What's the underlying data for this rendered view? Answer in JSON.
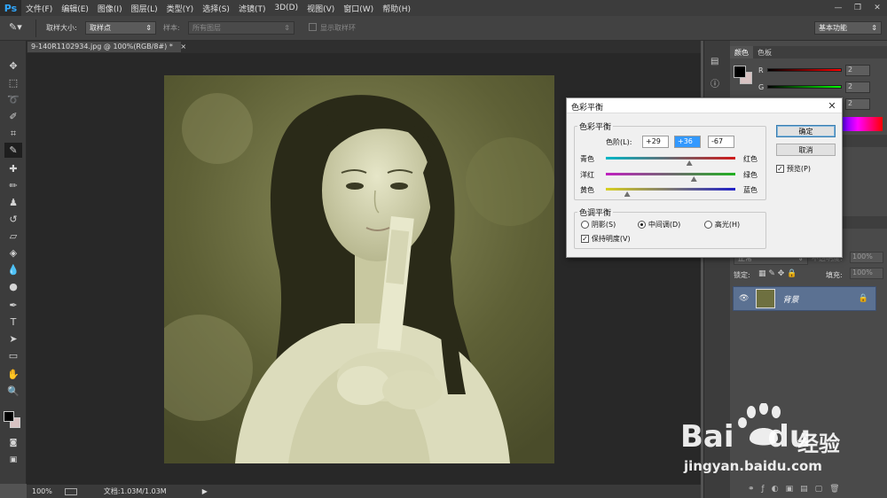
{
  "app": {
    "logo": "Ps"
  },
  "menu": [
    "文件(F)",
    "编辑(E)",
    "图像(I)",
    "图层(L)",
    "类型(Y)",
    "选择(S)",
    "滤镜(T)",
    "3D(D)",
    "视图(V)",
    "窗口(W)",
    "帮助(H)"
  ],
  "window_controls": {
    "minimize": "—",
    "restore": "❐",
    "close": "✕"
  },
  "options": {
    "sample_size_label": "取样大小:",
    "sample_size_value": "取样点",
    "sample_label": "样本:",
    "sample_value": "所有图层",
    "show_ring_label": "显示取样环",
    "workspace": "基本功能"
  },
  "document": {
    "tab_title": "9-140R1102934.jpg @ 100%(RGB/8#) *",
    "tab_close": "×"
  },
  "status": {
    "zoom": "100%",
    "doc": "文档:1.03M/1.03M",
    "arrow": "▶"
  },
  "color_panel": {
    "tabs": [
      "颜色",
      "色板"
    ],
    "channels": [
      {
        "label": "R",
        "value": "2"
      },
      {
        "label": "G",
        "value": "2"
      },
      {
        "label": "B",
        "value": "2"
      }
    ]
  },
  "layers_panel": {
    "mode": "正常",
    "opacity_label": "不透明度:",
    "opacity_value": "100%",
    "lock_label": "锁定:",
    "fill_label": "填充:",
    "fill_value": "100%",
    "layer_name": "背景"
  },
  "dialog": {
    "title": "色彩平衡",
    "close": "✕",
    "balance_group": "色彩平衡",
    "levels_label": "色阶(L):",
    "levels": [
      "+29",
      "+36",
      "-67"
    ],
    "sliders": [
      {
        "left": "青色",
        "right": "红色",
        "value": 29,
        "colors": [
          "#00b7c7",
          "#d01818"
        ]
      },
      {
        "left": "洋红",
        "right": "绿色",
        "value": 36,
        "colors": [
          "#c020c0",
          "#20b020"
        ]
      },
      {
        "left": "黄色",
        "right": "蓝色",
        "value": -67,
        "colors": [
          "#d8d020",
          "#2020c8"
        ]
      }
    ],
    "tone_group": "色调平衡",
    "tones": [
      {
        "label": "阴影(S)",
        "checked": false
      },
      {
        "label": "中间调(D)",
        "checked": true
      },
      {
        "label": "高光(H)",
        "checked": false
      }
    ],
    "preserve_label": "保持明度(V)",
    "ok": "确定",
    "cancel": "取消",
    "preview_label": "预览(P)"
  },
  "watermark": {
    "brand": "Bai",
    "brand2": "du",
    "brand_cn": "经验",
    "url": "jingyan.baidu.com"
  },
  "colors": {
    "photo_tint": "#c8c89a",
    "accent": "#31a8ff",
    "layer_selected": "#5b7192"
  }
}
